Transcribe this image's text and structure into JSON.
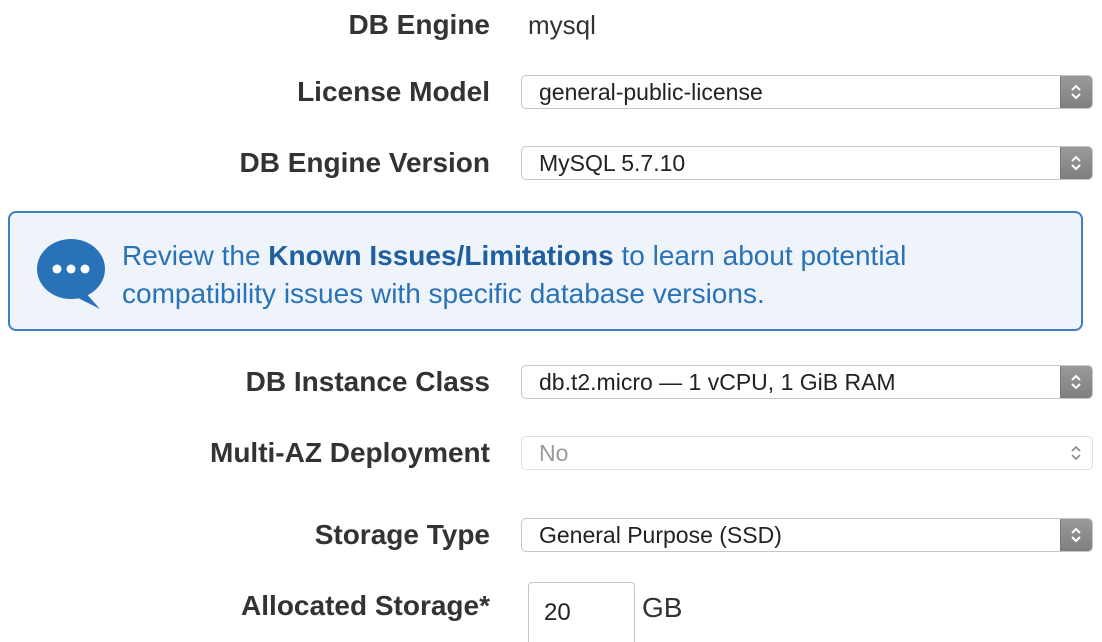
{
  "db_engine": {
    "label": "DB Engine",
    "value": "mysql"
  },
  "license_model": {
    "label": "License Model",
    "selected": "general-public-license"
  },
  "engine_version": {
    "label": "DB Engine Version",
    "selected": "MySQL 5.7.10"
  },
  "info_box": {
    "icon": "speech-bubble-ellipsis-icon",
    "text_before": "Review the ",
    "link_text": "Known Issues/Limitations",
    "text_after": " to learn about potential compatibility issues with specific database versions."
  },
  "instance_class": {
    "label": "DB Instance Class",
    "selected": "db.t2.micro — 1 vCPU, 1 GiB RAM"
  },
  "multi_az": {
    "label": "Multi-AZ Deployment",
    "selected": "No"
  },
  "storage_type": {
    "label": "Storage Type",
    "selected": "General Purpose (SSD)"
  },
  "allocated_storage": {
    "label": "Allocated Storage*",
    "value": "20",
    "unit": "GB"
  },
  "colors": {
    "accent": "#2a72b8",
    "info_border": "#3f7fbf",
    "info_background": "#eef4fa",
    "label_text": "#333333"
  }
}
